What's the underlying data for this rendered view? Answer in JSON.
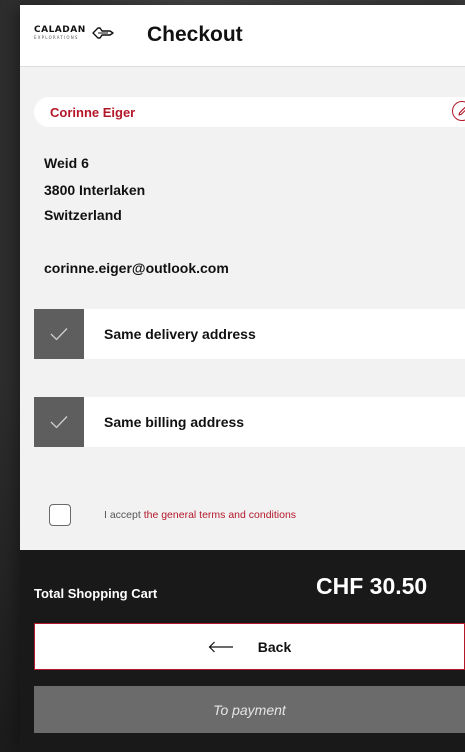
{
  "header": {
    "brand": "CALADAN",
    "brand_sub": "EXPLORATIONS",
    "logo_icon": "spaceship-icon",
    "title": "Checkout"
  },
  "customer": {
    "name": "Corinne Eiger",
    "edit_icon": "pencil-icon",
    "address_line1": "Weid 6",
    "address_line2": "3800 Interlaken",
    "address_line3": "Switzerland",
    "email": "corinne.eiger@outlook.com"
  },
  "options": {
    "delivery": {
      "label": "Same delivery address",
      "checked": true
    },
    "billing": {
      "label": "Same billing address",
      "checked": true
    }
  },
  "terms": {
    "prefix": "I accept",
    "link": "the general terms and conditions",
    "checked": false
  },
  "footer": {
    "total_label": "Total Shopping Cart",
    "total_amount": "CHF 30.50",
    "back_label": "Back",
    "back_icon": "arrow-left-icon",
    "payment_label": "To payment"
  },
  "colors": {
    "accent": "#b3182a",
    "footer_bg": "#191919",
    "checkbox_fill": "#5e5e5e",
    "payment_button": "#6b6b6b"
  }
}
